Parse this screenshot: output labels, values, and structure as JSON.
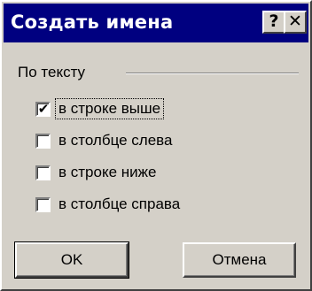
{
  "dialog": {
    "title": "Создать имена",
    "help_glyph": "?",
    "close_glyph": "✕"
  },
  "group": {
    "label": "По тексту"
  },
  "options": [
    {
      "label": "в строке выше",
      "checked": true,
      "mark": "✔"
    },
    {
      "label": "в столбце слева",
      "checked": false,
      "mark": ""
    },
    {
      "label": "в строке ниже",
      "checked": false,
      "mark": ""
    },
    {
      "label": "в столбце справа",
      "checked": false,
      "mark": ""
    }
  ],
  "buttons": {
    "ok": "OK",
    "cancel": "Отмена"
  },
  "colors": {
    "titlebar": "#000080",
    "face": "#d4d0c8"
  }
}
